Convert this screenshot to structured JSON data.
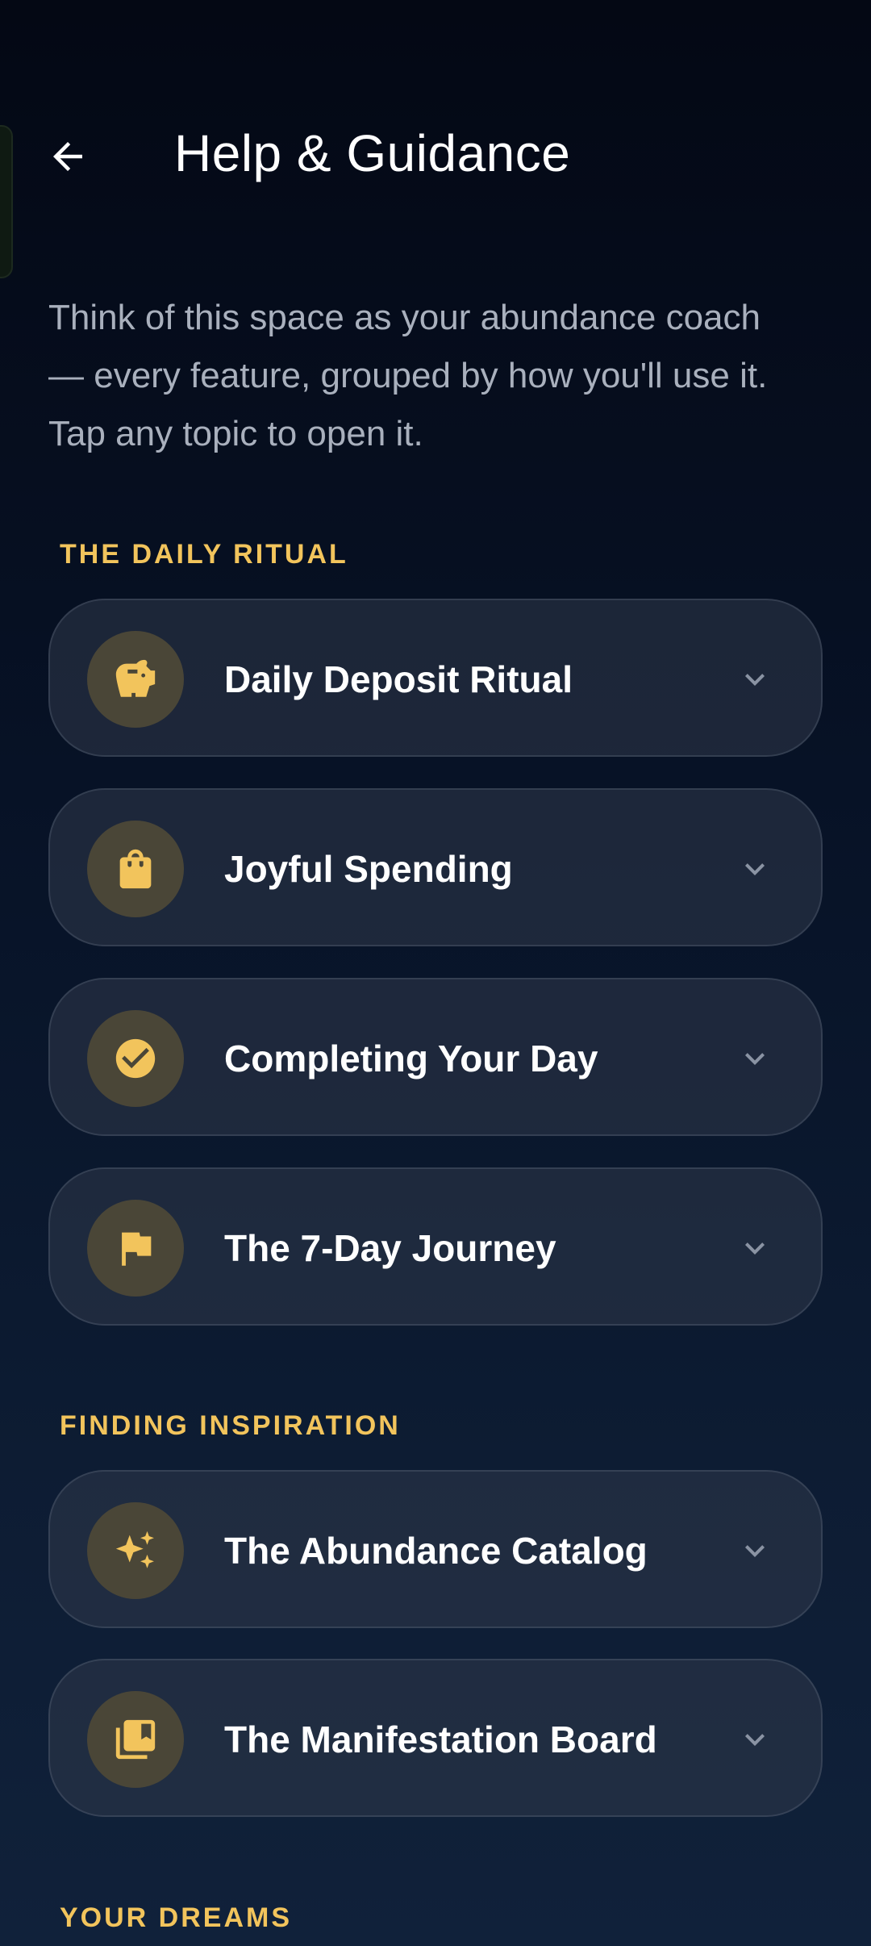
{
  "header": {
    "title": "Help & Guidance"
  },
  "intro": "Think of this space as your abundance coach — every feature, grouped by how you'll use it. Tap any topic to open it.",
  "sections": [
    {
      "label": "THE DAILY RITUAL",
      "items": [
        {
          "label": "Daily Deposit Ritual",
          "icon": "piggy-bank-icon"
        },
        {
          "label": "Joyful Spending",
          "icon": "shopping-bag-icon"
        },
        {
          "label": "Completing Your Day",
          "icon": "check-circle-icon"
        },
        {
          "label": "The 7-Day Journey",
          "icon": "flag-icon"
        }
      ]
    },
    {
      "label": "FINDING INSPIRATION",
      "items": [
        {
          "label": "The Abundance Catalog",
          "icon": "sparkles-icon"
        },
        {
          "label": "The Manifestation Board",
          "icon": "collections-bookmark-icon"
        }
      ]
    },
    {
      "label": "YOUR DREAMS",
      "items": []
    }
  ],
  "colors": {
    "accent": "#f2c45c",
    "background_top": "#040814",
    "background_bottom": "#10213a",
    "card": "#2a3244",
    "icon_circle": "#4a4637",
    "muted_text": "#a9b0bd"
  }
}
